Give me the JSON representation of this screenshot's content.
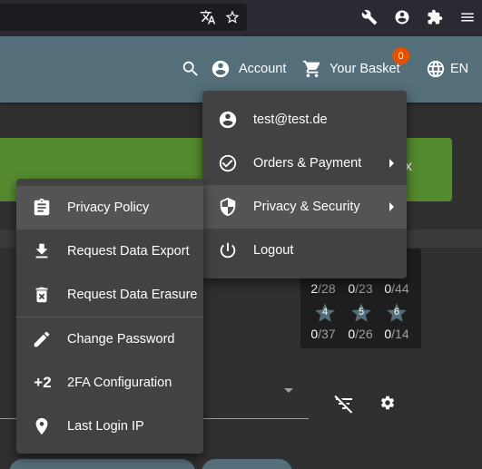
{
  "header": {
    "account_label": "Account",
    "basket_label": "Your Basket",
    "basket_count": "0",
    "language": "EN"
  },
  "account_menu": {
    "items": [
      {
        "label": "test@test.de",
        "icon": "account-circle-icon"
      },
      {
        "label": "Orders & Payment",
        "icon": "check-circle-icon"
      },
      {
        "label": "Privacy & Security",
        "icon": "shield-icon"
      },
      {
        "label": "Logout",
        "icon": "power-icon"
      }
    ]
  },
  "privacy_menu": {
    "items": [
      {
        "label": "Privacy Policy",
        "icon": "clipboard-icon"
      },
      {
        "label": "Request Data Export",
        "icon": "download-icon"
      },
      {
        "label": "Request Data Erasure",
        "icon": "delete-icon"
      },
      {
        "label": "Change Password",
        "icon": "pencil-icon"
      },
      {
        "label": "2FA Configuration",
        "icon": "plus-two-icon",
        "glyph": "+2"
      },
      {
        "label": "Last Login IP",
        "icon": "location-pin-icon"
      }
    ]
  },
  "background": {
    "banner_tail": "x",
    "score_card": {
      "row1": [
        {
          "solved": "2",
          "total": "/28"
        },
        {
          "solved": "0",
          "total": "/23"
        },
        {
          "solved": "0",
          "total": "/44"
        }
      ],
      "stars": [
        "4",
        "5",
        "6"
      ],
      "row2": [
        {
          "solved": "0",
          "total": "/37"
        },
        {
          "solved": "0",
          "total": "/26"
        },
        {
          "solved": "0",
          "total": "/14"
        }
      ]
    }
  },
  "colors": {
    "toolbar": "#546e7a",
    "banner": "#558b2f",
    "menu": "#424242",
    "badge": "#e65100"
  }
}
